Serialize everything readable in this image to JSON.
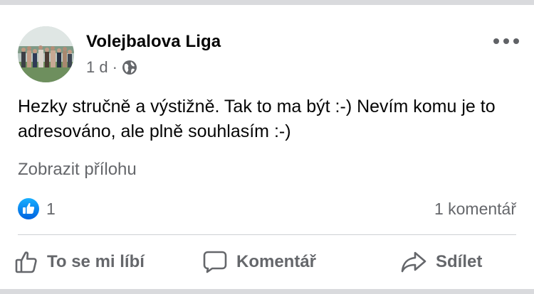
{
  "post": {
    "author": "Volejbalova Liga",
    "time": "1 d",
    "separator": "·",
    "audience_icon": "globe-icon",
    "text": "Hezky stručně a výstižně. Tak to ma být :-) Nevím komu je to adresováno, ale plně souhlasím :-)",
    "attachment_link": "Zobrazit přílohu"
  },
  "reactions": {
    "icon": "like-badge-icon",
    "count": "1",
    "comments": "1 komentář"
  },
  "actions": {
    "like": "To se mi líbí",
    "comment": "Komentář",
    "share": "Sdílet"
  },
  "colors": {
    "like_blue": "#1877f2",
    "secondary_text": "#65676b",
    "primary_text": "#050505",
    "divider": "#ced0d4"
  }
}
